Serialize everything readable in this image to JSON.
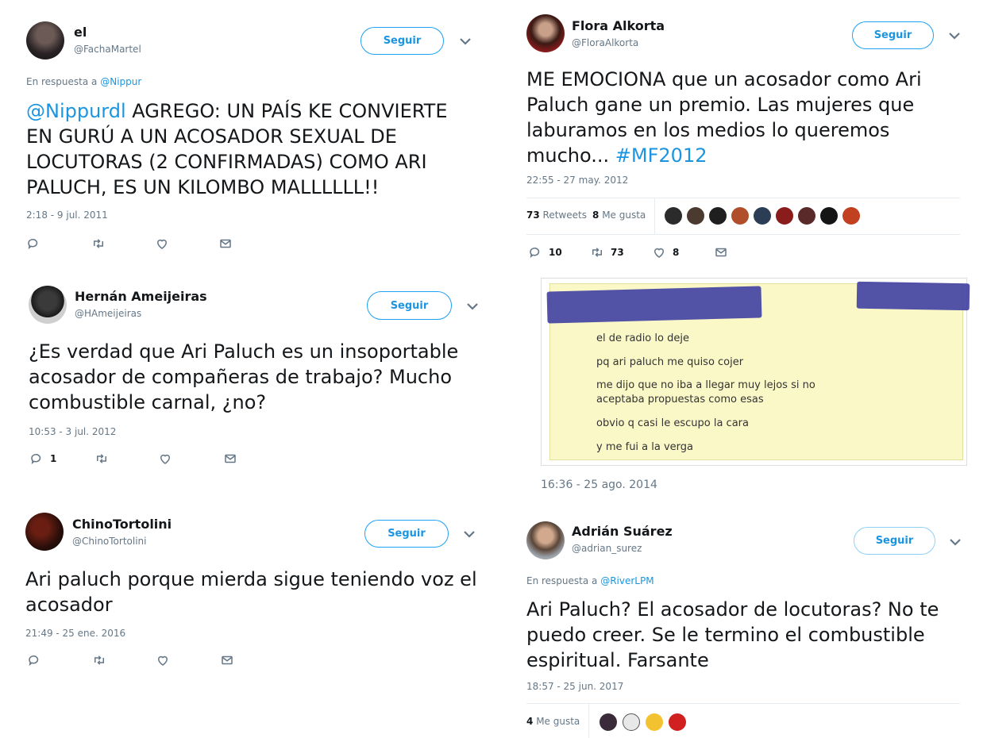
{
  "icons": {
    "reply": "reply-icon",
    "retweet": "retweet-icon",
    "like": "heart-icon",
    "dm": "envelope-icon",
    "chevron": "chevron-down-icon"
  },
  "colors": {
    "accent": "#1da1f2",
    "link": "#1b95e0",
    "muted": "#657786",
    "redaction": "#3f3fa2",
    "chat_bg": "#fbf8c8"
  },
  "tweets": [
    {
      "name": "el",
      "handle": "@FachaMartel",
      "follow": "Seguir",
      "reply_prefix": "En respuesta a ",
      "reply_user": "@Nippur",
      "mention": "@Nippurdl",
      "text": " AGREGO: UN PAÍS KE CONVIERTE EN GURÚ A UN ACOSADOR SEXUAL DE LOCUTORAS (2 CONFIRMADAS) COMO ARI PALUCH, ES UN KILOMBO MALLLLLL!!",
      "time": "2:18 - 9 jul. 2011"
    },
    {
      "name": "Hernán Ameijeiras",
      "handle": "@HAmeijeiras",
      "follow": "Seguir",
      "text": "¿Es verdad que Ari Paluch es un  insoportable acosador de compañeras de trabajo? Mucho combustible carnal, ¿no?",
      "time": "10:53 - 3 jul. 2012",
      "replies": "1"
    },
    {
      "name": "ChinoTortolini",
      "handle": "@ChinoTortolini",
      "follow": "Seguir",
      "text": "Ari paluch porque mierda sigue teniendo voz el acosador",
      "time": "21:49 - 25 ene. 2016"
    },
    {
      "name": "Flora Alkorta",
      "handle": "@FloraAlkorta",
      "follow": "Seguir",
      "text": "ME EMOCIONA que un acosador como Ari Paluch  gane un premio. Las mujeres que laburamos en los medios lo queremos mucho...  ",
      "hashtag": "#MF2012",
      "time": "22:55 - 27 may. 2012",
      "retweets_count": "73",
      "retweets_label": "Retweets",
      "likes_count": "8",
      "likes_label": "Me gusta",
      "replies": "10",
      "retweets": "73",
      "likes": "8"
    },
    {
      "chat_lines": [
        "el de radio lo deje",
        "pq ari paluch me quiso cojer",
        "me dijo que no iba a llegar muy lejos si no aceptaba propuestas como esas",
        "obvio q casi le escupo la cara",
        "y me fui a la verga"
      ],
      "time": "16:36 - 25 ago. 2014"
    },
    {
      "name": "Adrián Suárez",
      "handle": "@adrian_surez",
      "follow": "Seguir",
      "reply_prefix": "En respuesta a ",
      "reply_user": "@RiverLPM",
      "text": "Ari Paluch? El acosador de locutoras? No te puedo creer. Se le termino el combustible espiritual. Farsante",
      "time": "18:57 - 25 jun. 2017",
      "likes_count": "4",
      "likes_label": "Me gusta"
    }
  ]
}
